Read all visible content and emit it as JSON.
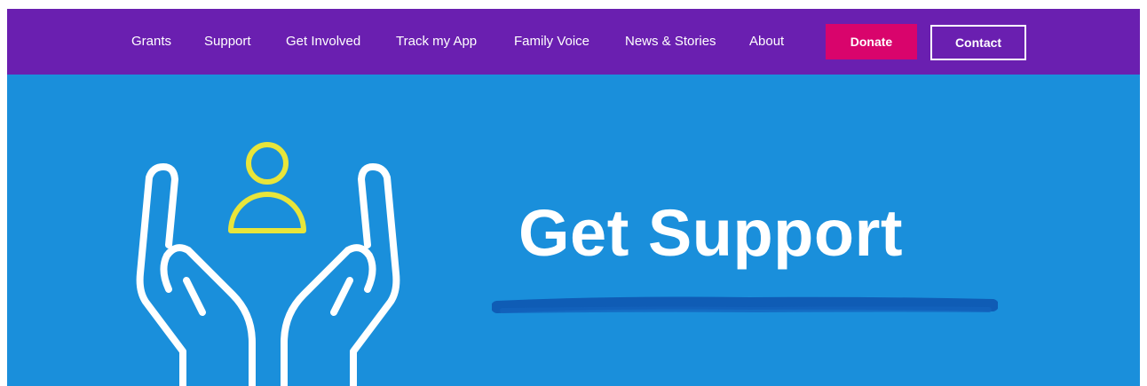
{
  "nav": {
    "items": [
      {
        "label": "Grants",
        "name": "nav-grants"
      },
      {
        "label": "Support",
        "name": "nav-support"
      },
      {
        "label": "Get Involved",
        "name": "nav-get-involved"
      },
      {
        "label": "Track my App",
        "name": "nav-track-my-app"
      },
      {
        "label": "Family Voice",
        "name": "nav-family-voice"
      },
      {
        "label": "News & Stories",
        "name": "nav-news-stories"
      },
      {
        "label": "About",
        "name": "nav-about"
      }
    ],
    "donate_label": "Donate",
    "contact_label": "Contact"
  },
  "hero": {
    "title": "Get Support",
    "illustration_icon": "hands-holding-person-icon"
  },
  "colors": {
    "nav_background": "#6a1fb0",
    "donate_button": "#d9046c",
    "hero_background": "#1a8fdb",
    "underline_stroke": "#0f5cb5",
    "person_icon": "#e8e53a",
    "hands_icon": "#ffffff"
  }
}
